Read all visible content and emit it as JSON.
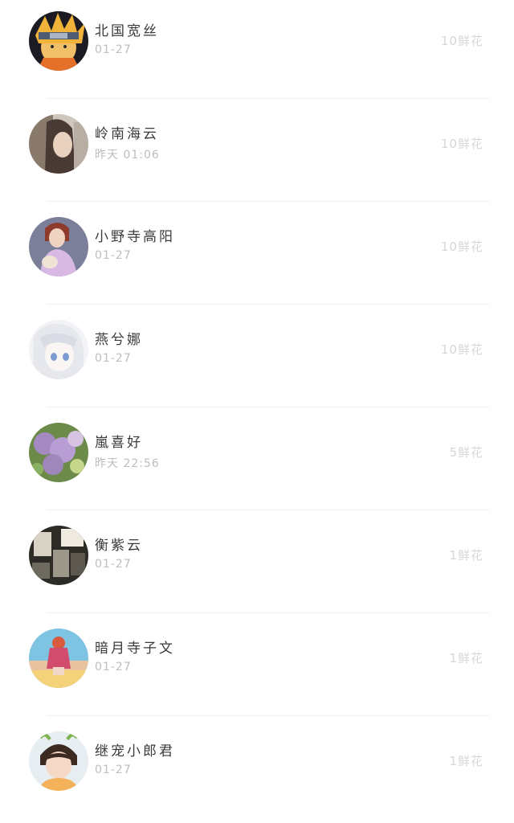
{
  "list": {
    "items": [
      {
        "name": "北国宽丝",
        "time": "01-27",
        "flowers": "10鲜花",
        "avatar_icon": "naruto-avatar"
      },
      {
        "name": "岭南海云",
        "time": "昨天 01:06",
        "flowers": "10鲜花",
        "avatar_icon": "woman-hair-avatar"
      },
      {
        "name": "小野寺高阳",
        "time": "01-27",
        "flowers": "10鲜花",
        "avatar_icon": "girl-purple-dress-avatar"
      },
      {
        "name": "燕兮娜",
        "time": "01-27",
        "flowers": "10鲜花",
        "avatar_icon": "anime-girl-avatar"
      },
      {
        "name": "嵐喜好",
        "time": "昨天 22:56",
        "flowers": "5鲜花",
        "avatar_icon": "flowers-avatar"
      },
      {
        "name": "衡紫云",
        "time": "01-27",
        "flowers": "1鲜花",
        "avatar_icon": "dark-room-avatar"
      },
      {
        "name": "暗月寺子文",
        "time": "01-27",
        "flowers": "1鲜花",
        "avatar_icon": "girl-on-bed-avatar"
      },
      {
        "name": "继宠小郎君",
        "time": "01-27",
        "flowers": "1鲜花",
        "avatar_icon": "child-avatar"
      }
    ]
  }
}
